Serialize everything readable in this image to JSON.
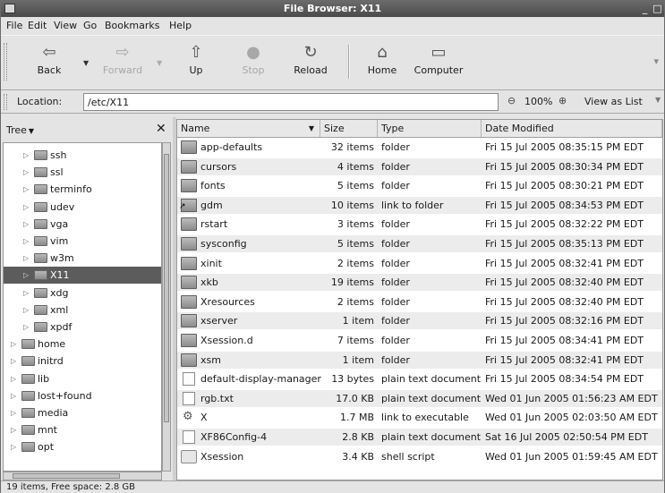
{
  "window": {
    "title": "File Browser: X11",
    "minimize_glyph": "_",
    "maximize_glyph": "□"
  },
  "menu": [
    "File",
    "Edit",
    "View",
    "Go",
    "Bookmarks",
    "Help"
  ],
  "toolbar": {
    "back": "Back",
    "forward": "Forward",
    "up": "Up",
    "stop": "Stop",
    "reload": "Reload",
    "home": "Home",
    "computer": "Computer"
  },
  "location": {
    "label": "Location:",
    "value": "/etc/X11",
    "zoom": "100%",
    "view_as": "View as List"
  },
  "sidebar": {
    "title": "Tree",
    "items": [
      {
        "label": "ssh",
        "level": 1,
        "selected": false
      },
      {
        "label": "ssl",
        "level": 1,
        "selected": false
      },
      {
        "label": "terminfo",
        "level": 1,
        "selected": false
      },
      {
        "label": "udev",
        "level": 1,
        "selected": false
      },
      {
        "label": "vga",
        "level": 1,
        "selected": false
      },
      {
        "label": "vim",
        "level": 1,
        "selected": false
      },
      {
        "label": "w3m",
        "level": 1,
        "selected": false
      },
      {
        "label": "X11",
        "level": 1,
        "selected": true
      },
      {
        "label": "xdg",
        "level": 1,
        "selected": false
      },
      {
        "label": "xml",
        "level": 1,
        "selected": false
      },
      {
        "label": "xpdf",
        "level": 1,
        "selected": false
      },
      {
        "label": "home",
        "level": 0,
        "selected": false
      },
      {
        "label": "initrd",
        "level": 0,
        "selected": false
      },
      {
        "label": "lib",
        "level": 0,
        "selected": false
      },
      {
        "label": "lost+found",
        "level": 0,
        "selected": false
      },
      {
        "label": "media",
        "level": 0,
        "selected": false
      },
      {
        "label": "mnt",
        "level": 0,
        "selected": false
      },
      {
        "label": "opt",
        "level": 0,
        "selected": false
      }
    ]
  },
  "files": {
    "columns": {
      "name": "Name",
      "size": "Size",
      "type": "Type",
      "date": "Date Modified"
    },
    "rows": [
      {
        "name": "app-defaults",
        "size": "32 items",
        "type": "folder",
        "date": "Fri 15 Jul 2005 08:35:15 PM EDT",
        "icon": "folder"
      },
      {
        "name": "cursors",
        "size": "4 items",
        "type": "folder",
        "date": "Fri 15 Jul 2005 08:30:34 PM EDT",
        "icon": "folder"
      },
      {
        "name": "fonts",
        "size": "5 items",
        "type": "folder",
        "date": "Fri 15 Jul 2005 08:30:21 PM EDT",
        "icon": "folder"
      },
      {
        "name": "gdm",
        "size": "10 items",
        "type": "link to folder",
        "date": "Fri 15 Jul 2005 08:34:53 PM EDT",
        "icon": "link"
      },
      {
        "name": "rstart",
        "size": "3 items",
        "type": "folder",
        "date": "Fri 15 Jul 2005 08:32:22 PM EDT",
        "icon": "folder"
      },
      {
        "name": "sysconfig",
        "size": "5 items",
        "type": "folder",
        "date": "Fri 15 Jul 2005 08:35:13 PM EDT",
        "icon": "folder"
      },
      {
        "name": "xinit",
        "size": "2 items",
        "type": "folder",
        "date": "Fri 15 Jul 2005 08:32:41 PM EDT",
        "icon": "folder"
      },
      {
        "name": "xkb",
        "size": "19 items",
        "type": "folder",
        "date": "Fri 15 Jul 2005 08:32:40 PM EDT",
        "icon": "folder"
      },
      {
        "name": "Xresources",
        "size": "2 items",
        "type": "folder",
        "date": "Fri 15 Jul 2005 08:32:40 PM EDT",
        "icon": "folder"
      },
      {
        "name": "xserver",
        "size": "1 item",
        "type": "folder",
        "date": "Fri 15 Jul 2005 08:32:16 PM EDT",
        "icon": "folder"
      },
      {
        "name": "Xsession.d",
        "size": "7 items",
        "type": "folder",
        "date": "Fri 15 Jul 2005 08:34:41 PM EDT",
        "icon": "folder"
      },
      {
        "name": "xsm",
        "size": "1 item",
        "type": "folder",
        "date": "Fri 15 Jul 2005 08:32:41 PM EDT",
        "icon": "folder"
      },
      {
        "name": "default-display-manager",
        "size": "13 bytes",
        "type": "plain text document",
        "date": "Fri 15 Jul 2005 08:34:54 PM EDT",
        "icon": "doc"
      },
      {
        "name": "rgb.txt",
        "size": "17.0 KB",
        "type": "plain text document",
        "date": "Wed 01 Jun 2005 01:56:23 AM EDT",
        "icon": "doc"
      },
      {
        "name": "X",
        "size": "1.7 MB",
        "type": "link to executable",
        "date": "Wed 01 Jun 2005 02:03:50 AM EDT",
        "icon": "exec"
      },
      {
        "name": "XF86Config-4",
        "size": "2.8 KB",
        "type": "plain text document",
        "date": "Sat 16 Jul 2005 02:50:54 PM EDT",
        "icon": "doc"
      },
      {
        "name": "Xsession",
        "size": "3.4 KB",
        "type": "shell script",
        "date": "Wed 01 Jun 2005 01:59:45 AM EDT",
        "icon": "script"
      }
    ]
  },
  "status": "19 items, Free space: 2.8 GB"
}
